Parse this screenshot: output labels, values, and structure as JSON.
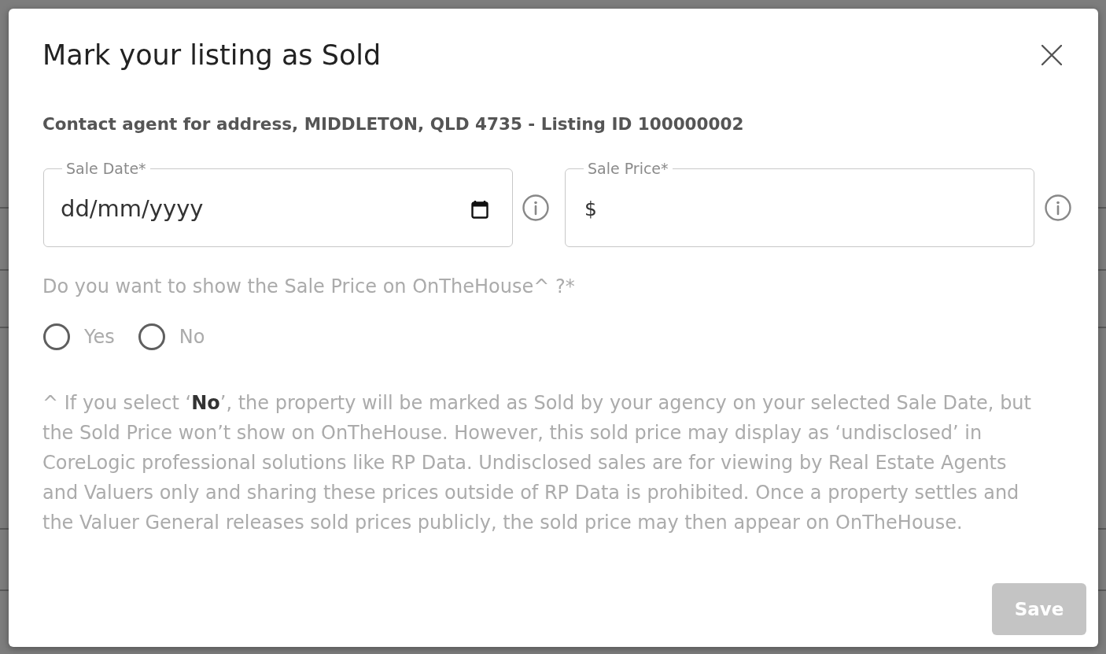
{
  "dialog": {
    "title": "Mark your listing as Sold",
    "subtitle": "Contact agent for address, MIDDLETON, QLD 4735 - Listing ID 100000002"
  },
  "fields": [
    {
      "kind": "date",
      "label": "Sale Date*",
      "placeholder": "dd/mm/yyyy"
    },
    {
      "kind": "price",
      "label": "Sale Price*",
      "prefix": "$"
    }
  ],
  "question": {
    "text": "Do you want to show the Sale Price on OnTheHouse^ ?*",
    "options": [
      {
        "label": "Yes",
        "selected": false
      },
      {
        "label": "No",
        "selected": false
      }
    ]
  },
  "note": "^ If you select ‘**No**’, the property will be marked as Sold by your agency on your selected Sale Date, but the Sold Price won’t show on OnTheHouse. However, this sold price may display as ‘undisclosed’ in CoreLogic professional solutions like RP Data. Undisclosed sales are for viewing by Real Estate Agents and Valuers only and sharing these prices outside of RP Data is prohibited. Once a property settles and the Valuer General releases sold prices publicly, the sold price may then appear on OnTheHouse.",
  "save_button": {
    "label": "Save",
    "disabled": true
  }
}
